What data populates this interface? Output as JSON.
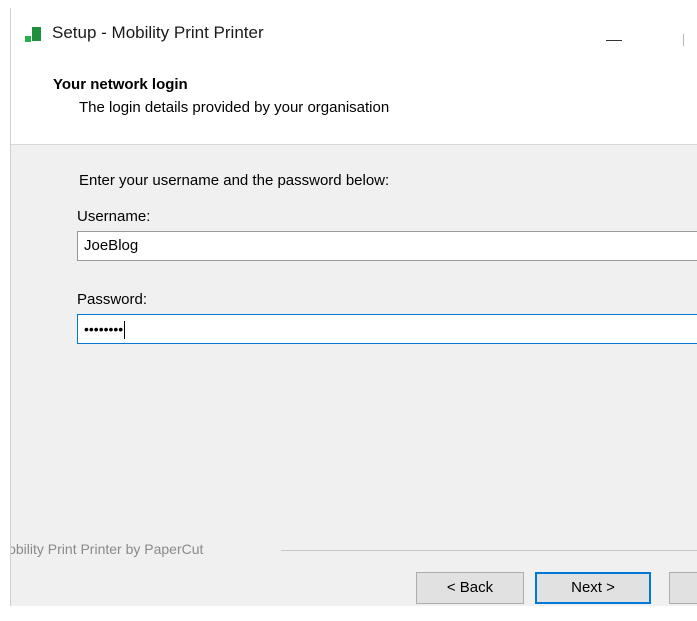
{
  "window": {
    "title": "Setup - Mobility Print Printer"
  },
  "header": {
    "title": "Your network login",
    "subtitle": "The login details provided by your organisation"
  },
  "form": {
    "instruction": "Enter your username and the password below:",
    "username_label": "Username:",
    "username_value": "JoeBlog",
    "password_label": "Password:",
    "password_value": "••••••••"
  },
  "footer": {
    "branding": "lobility Print Printer by PaperCut",
    "back_label": "< Back",
    "next_label": "Next >"
  },
  "colors": {
    "focus": "#0078d7",
    "icon_green": "#1e8f3c"
  }
}
